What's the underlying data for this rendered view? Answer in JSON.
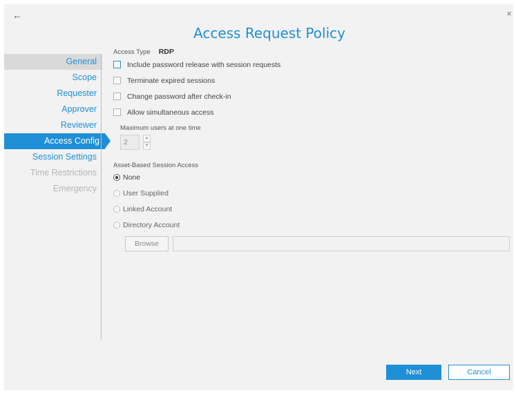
{
  "window": {
    "back_icon": "←",
    "close_icon": "×"
  },
  "title": "Access Request Policy",
  "sidebar": {
    "items": [
      {
        "label": "General"
      },
      {
        "label": "Scope"
      },
      {
        "label": "Requester"
      },
      {
        "label": "Approver"
      },
      {
        "label": "Reviewer"
      },
      {
        "label": "Access Config"
      },
      {
        "label": "Session Settings"
      },
      {
        "label": "Time Restrictions"
      },
      {
        "label": "Emergency"
      }
    ]
  },
  "access_type": {
    "label": "Access Type",
    "value": "RDP"
  },
  "options": [
    {
      "label": "Include password release with session requests",
      "checked": false
    },
    {
      "label": "Terminate expired sessions",
      "checked": false
    },
    {
      "label": "Change password after check-in",
      "checked": false
    },
    {
      "label": "Allow simultaneous access",
      "checked": false
    }
  ],
  "max_users": {
    "label": "Maximum users at one time",
    "value": "2",
    "up_icon": "▲",
    "down_icon": "▼"
  },
  "asset_access": {
    "label": "Asset-Based Session Access",
    "options": [
      {
        "label": "None",
        "selected": true
      },
      {
        "label": "User Supplied",
        "selected": false
      },
      {
        "label": "Linked Account",
        "selected": false
      },
      {
        "label": "Directory Account",
        "selected": false
      }
    ],
    "browse_label": "Browse",
    "path_value": ""
  },
  "footer": {
    "next_label": "Next",
    "cancel_label": "Cancel"
  },
  "colors": {
    "accent": "#1f8fd6",
    "background": "#f2f2f2"
  }
}
